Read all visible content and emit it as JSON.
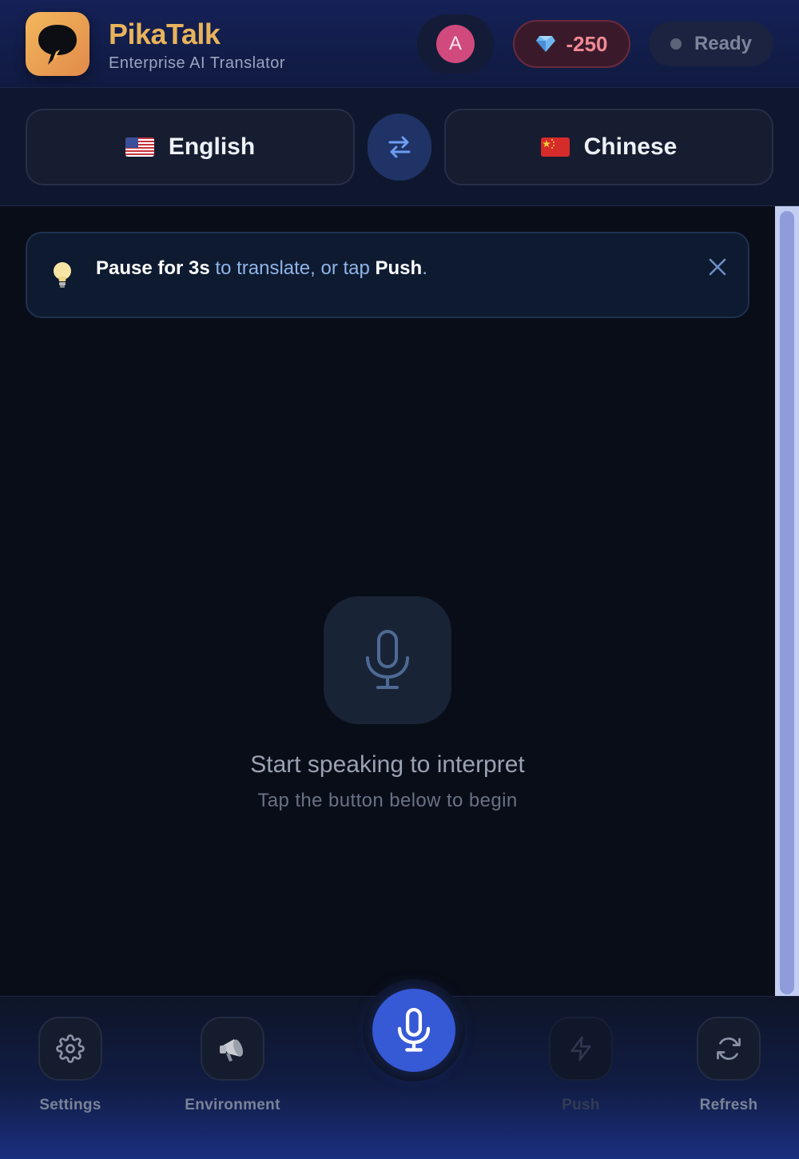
{
  "header": {
    "app_name": "PikaTalk",
    "subtitle": "Enterprise AI Translator",
    "logo_icon": "chat-bubble-lightning-icon",
    "avatar_letter": "A",
    "credits": "-250",
    "credits_icon": "diamond-icon",
    "status": "Ready"
  },
  "languages": {
    "source": {
      "label": "English",
      "flag": "us-flag-icon"
    },
    "target": {
      "label": "Chinese",
      "flag": "cn-flag-icon"
    },
    "swap_icon": "swap-arrows-icon"
  },
  "tip": {
    "icon": "lightbulb-icon",
    "bold1": "Pause for 3s",
    "text1": " to translate, or tap ",
    "bold2": "Push",
    "text2": ".",
    "close_icon": "close-icon"
  },
  "empty_state": {
    "title": "Start speaking to interpret",
    "subtitle": "Tap the button below to begin",
    "icon": "microphone-icon"
  },
  "toolbar": {
    "settings_label": "Settings",
    "environment_label": "Environment",
    "push_label": "Push",
    "refresh_label": "Refresh"
  },
  "colors": {
    "brand": "#e8b35a",
    "accent": "#3659d6",
    "credits_negative": "#f08a94"
  }
}
